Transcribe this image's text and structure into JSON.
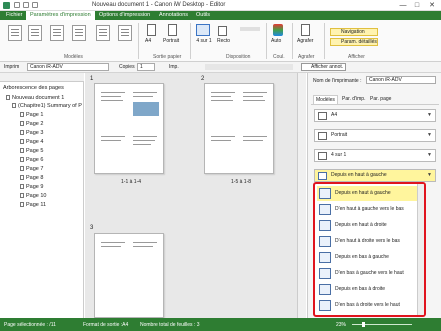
{
  "window": {
    "title": "Nouveau document 1 - Canon iW Desktop - Editor",
    "minimize": "—",
    "maximize": "□",
    "close": "✕"
  },
  "tabs": [
    {
      "label": "Fichier"
    },
    {
      "label": "Paramètres d'impression"
    },
    {
      "label": "Options d'impression"
    },
    {
      "label": "Annotations"
    },
    {
      "label": "Outils"
    }
  ],
  "ribbon": {
    "groups": {
      "modeles": "Modèles",
      "sortie_papier": "Sortie papier",
      "disposition": "Disposition",
      "coul": "Coul.",
      "agrafer": "Agrafer",
      "afficher": "Afficher"
    },
    "buttons": {
      "format": "A4",
      "portrait": "Portrait",
      "nup": "4 sur 1",
      "recto": "Recto",
      "auto": "Auto",
      "agrafer": "Agrafer",
      "navigation": "Navigation",
      "param_details": "Param. détaillés"
    }
  },
  "toolbar2": {
    "imprim_label": "Imprim",
    "printer": "Canon iR-ADV",
    "copies_label": "Copies",
    "copies_value": "1",
    "imp_label": "Imp.",
    "afficher_annot": "Afficher annot."
  },
  "tree": {
    "header": "Arborescence des pages",
    "root": "Nouveau document 1",
    "chapter": "(Chapitre1) Summary of P",
    "pages": [
      "Page 1",
      "Page 2",
      "Page 3",
      "Page 4",
      "Page 5",
      "Page 6",
      "Page 7",
      "Page 8",
      "Page 9",
      "Page 10",
      "Page 11"
    ]
  },
  "preview": {
    "sheet1_num": "1",
    "sheet2_num": "2",
    "sheet3_num": "3",
    "sheet1_caption": "1-1 à 1-4",
    "sheet2_caption": "1-5 à 1-8"
  },
  "rightpanel": {
    "printer_label": "Nom de l'imprimante :",
    "printer_value": "Canon iR-ADV",
    "tabs": [
      "Modèles",
      "Par. d'imp.",
      "Par. page"
    ],
    "paper": "A4",
    "orientation": "Portrait",
    "nup": "4 sur 1",
    "order": "Depuis en haut à gauche"
  },
  "dropdown": {
    "options": [
      "Depuis en haut à gauche",
      "D'en haut à gauche vers le bas",
      "Depuis en haut à droite",
      "D'en haut à droite vers le bas",
      "Depuis en bas à gauche",
      "D'en bas à gauche vers le haut",
      "Depuis en bas à droite",
      "D'en bas à droite vers le haut"
    ],
    "selected_index": 0
  },
  "status": {
    "page_selected": "Page sélectionnée : /11",
    "format": "Format de sortie :A4",
    "sheets": "Nombre total de feuilles : 3",
    "zoom": "23%"
  },
  "colors": {
    "accent": "#2e7d32",
    "highlight": "#fff59d",
    "callout": "#e0141e"
  }
}
